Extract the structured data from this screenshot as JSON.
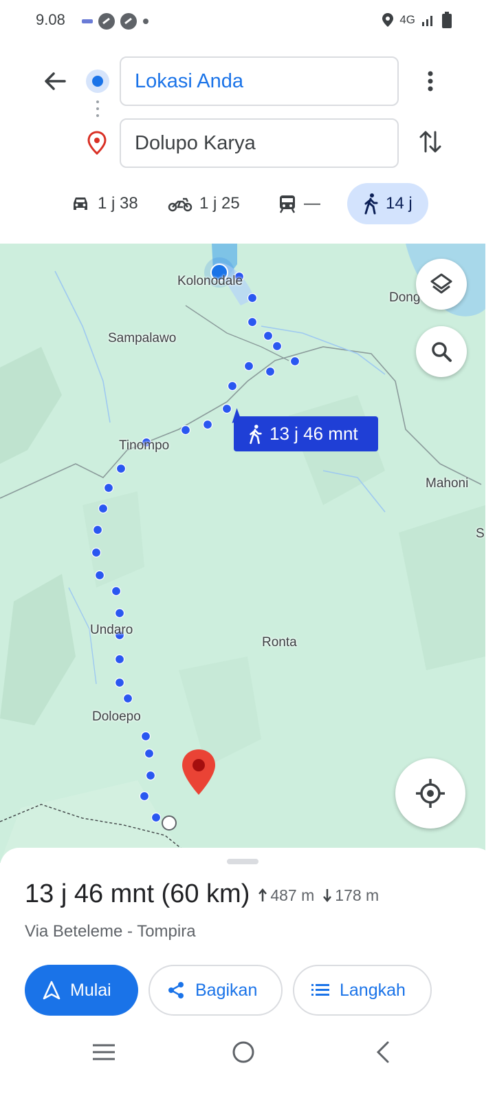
{
  "status_bar": {
    "time": "9.08",
    "network": "4G",
    "icons": [
      "app-icon",
      "app-icon",
      "app-icon",
      "dot-icon",
      "location-icon",
      "signal-icon",
      "battery-icon"
    ]
  },
  "directions": {
    "origin": "Lokasi Anda",
    "destination": "Dolupo Karya",
    "modes": [
      {
        "name": "car",
        "icon": "car-icon",
        "value": "1 j 38"
      },
      {
        "name": "motorcycle",
        "icon": "motorcycle-icon",
        "value": "1 j 25"
      },
      {
        "name": "transit",
        "icon": "train-icon",
        "value": "—"
      },
      {
        "name": "walk",
        "icon": "walk-icon",
        "value": "14 j",
        "selected": true
      }
    ]
  },
  "map": {
    "labels": {
      "kolonodale": "Kolonodale",
      "dong": "Dong",
      "sampalawo": "Sampalawo",
      "tinompo": "Tinompo",
      "mahoni": "Mahoni",
      "s_edge": "S",
      "undaro": "Undaro",
      "ronta": "Ronta",
      "doloepo": "Doloepo"
    },
    "route_callout": "13 j 46 mnt",
    "colors": {
      "land": "#cdeedd",
      "water": "#a8d8ea",
      "route": "#2a57f0",
      "marker": "#ea4335"
    }
  },
  "summary": {
    "duration_distance": "13 j 46 mnt (60 km)",
    "ascent": "487 m",
    "descent": "178 m",
    "via": "Via Beteleme - Tompira"
  },
  "actions": {
    "start": "Mulai",
    "share": "Bagikan",
    "steps": "Langkah"
  }
}
